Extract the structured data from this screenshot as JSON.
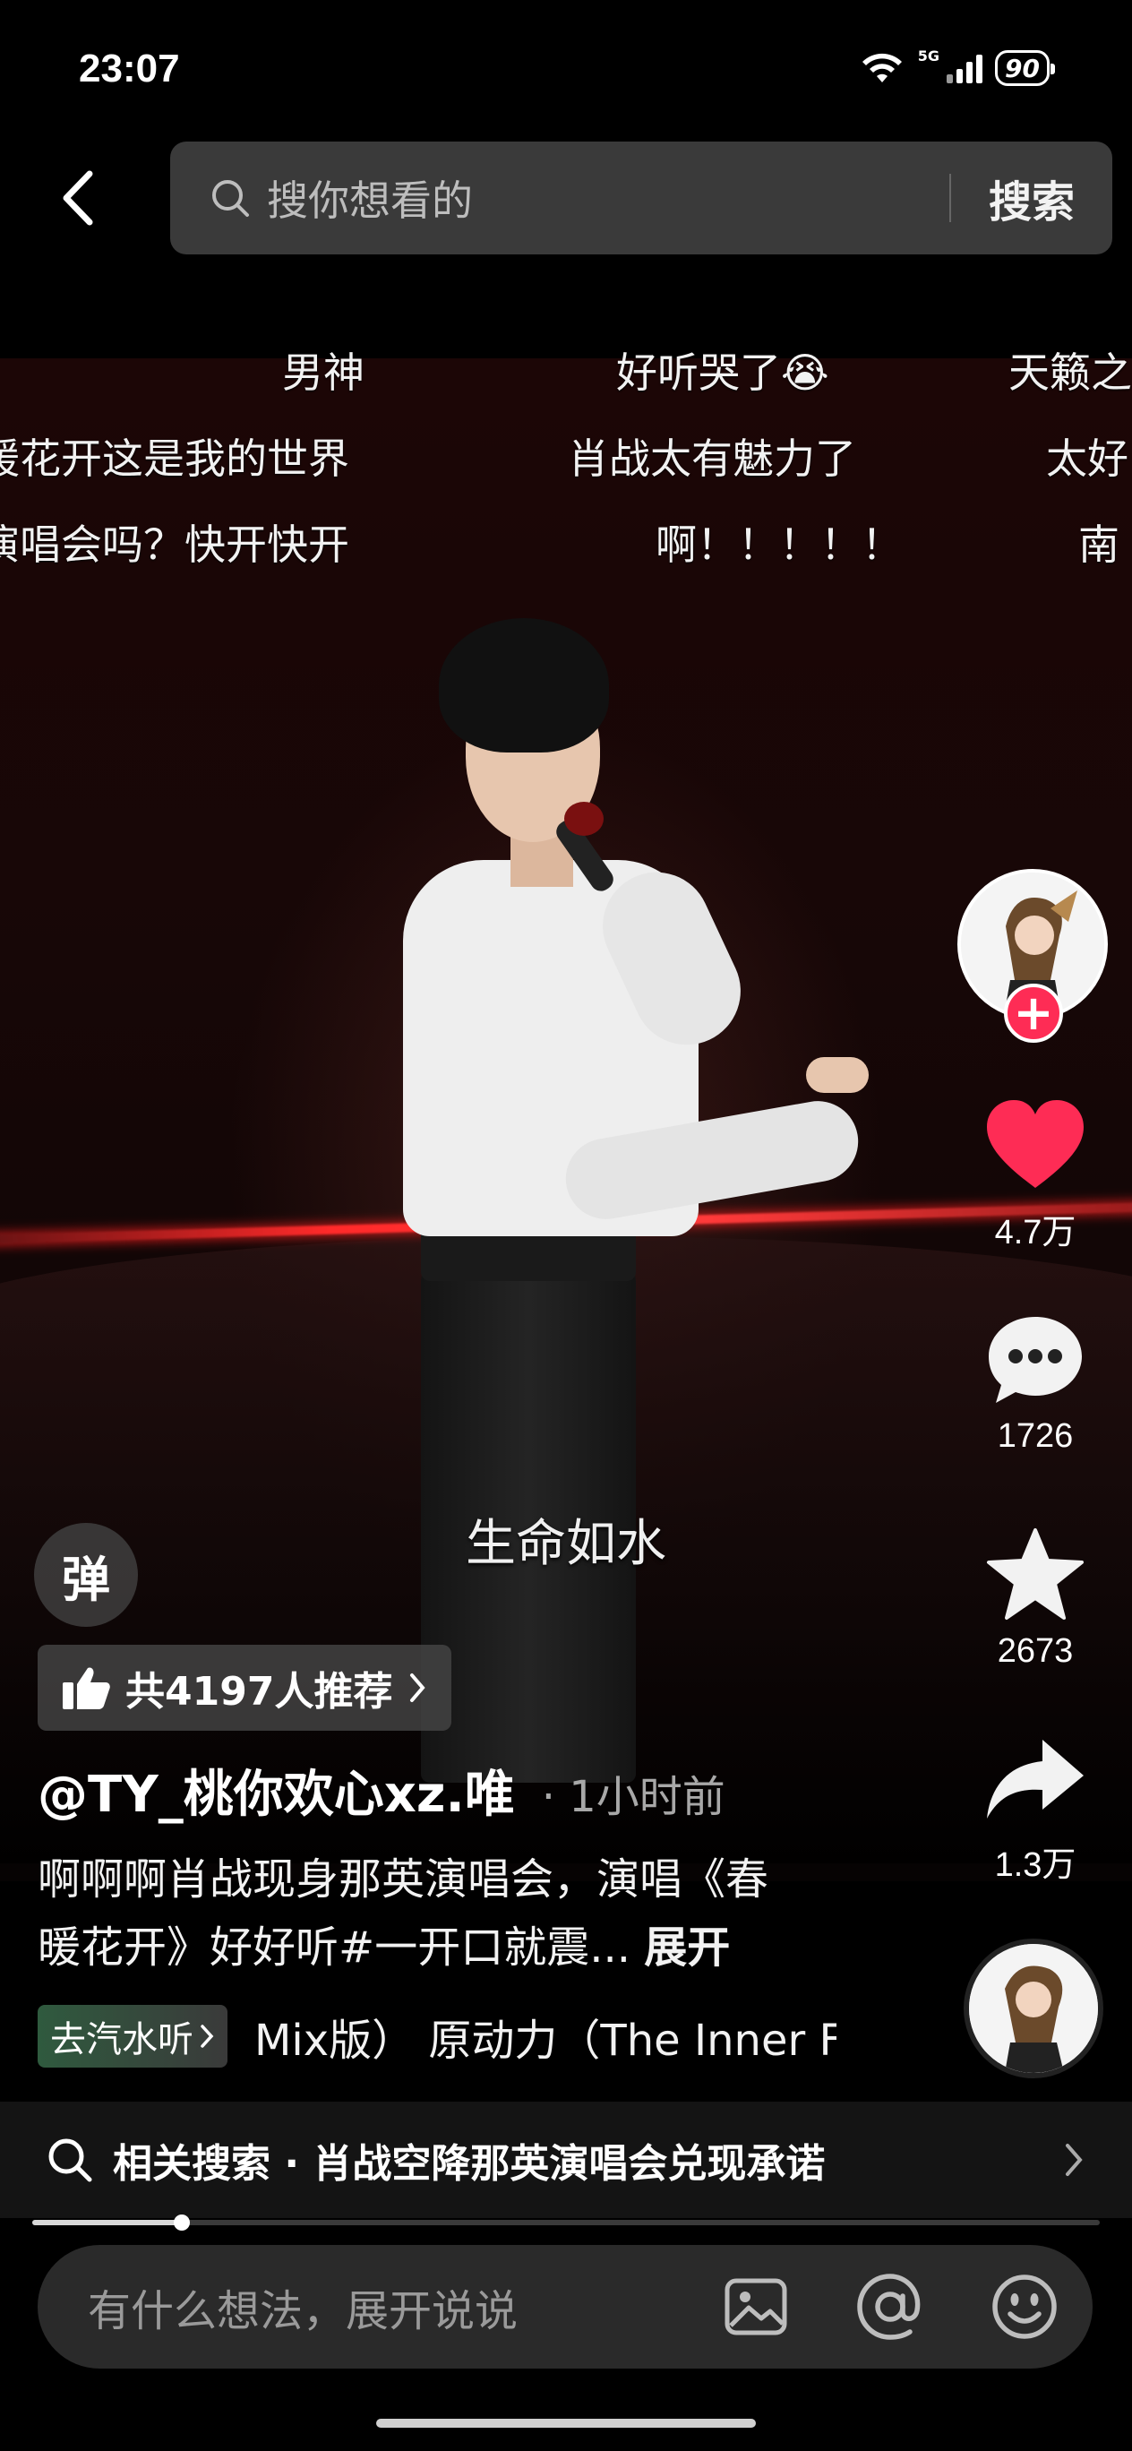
{
  "status_bar": {
    "time": "23:07",
    "network": "5G",
    "battery": "90"
  },
  "search": {
    "placeholder": "搜你想看的",
    "button_label": "搜索"
  },
  "danmaku": [
    "男神",
    "好听哭了😭",
    "天籁之",
    "暖花开这是我的世界",
    "肖战太有魅力了",
    "太好",
    "演唱会吗？快开快开",
    "啊！！！！！",
    "南"
  ],
  "lyric": "生命如水",
  "danmaku_toggle": "弹",
  "recommend": {
    "label": "共4197人推荐"
  },
  "author": "@TY_桃你欢心xz.唯",
  "post_time": "· 1小时前",
  "caption": {
    "line1": "啊啊啊肖战现身那英演唱会，演唱《春",
    "line2": "暖花开》好好听#一开口就震...",
    "expand": "展开"
  },
  "music": {
    "tag": "去汽水听",
    "title": "Mix版） 原动力（The Inner F"
  },
  "actions": {
    "likes": "4.7万",
    "comments": "1726",
    "favorites": "2673",
    "shares": "1.3万"
  },
  "related_search": {
    "label": "相关搜索 · 肖战空降那英演唱会兑现承诺"
  },
  "progress": {
    "fraction": 0.14
  },
  "comment_input": {
    "placeholder": "有什么想法，展开说说"
  },
  "colors": {
    "like": "#fe2c55",
    "follow": "#fe2c55",
    "background": "#000000"
  }
}
